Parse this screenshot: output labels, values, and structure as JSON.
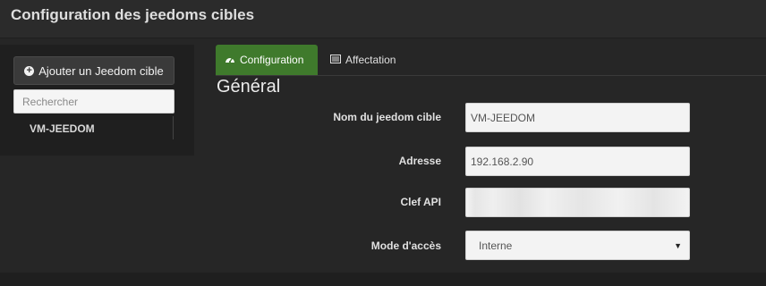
{
  "page": {
    "title": "Configuration des jeedoms cibles"
  },
  "sidebar": {
    "add_button_label": "Ajouter un Jeedom cible",
    "search_placeholder": "Rechercher",
    "items": [
      {
        "label": "VM-JEEDOM"
      }
    ]
  },
  "tabs": [
    {
      "label": "Configuration",
      "icon": "dashboard-icon",
      "active": true
    },
    {
      "label": "Affectation",
      "icon": "list-icon",
      "active": false
    }
  ],
  "form": {
    "section_title": "Général",
    "fields": {
      "name": {
        "label": "Nom du jeedom cible",
        "value": "VM-JEEDOM"
      },
      "address": {
        "label": "Adresse",
        "value": "192.168.2.90"
      },
      "api_key": {
        "label": "Clef API",
        "value": ""
      },
      "access_mode": {
        "label": "Mode d'accès",
        "selected": "Interne"
      }
    }
  },
  "colors": {
    "active_tab": "#3f7a2c",
    "background": "#262626",
    "sidebar": "#1f1f1f"
  }
}
